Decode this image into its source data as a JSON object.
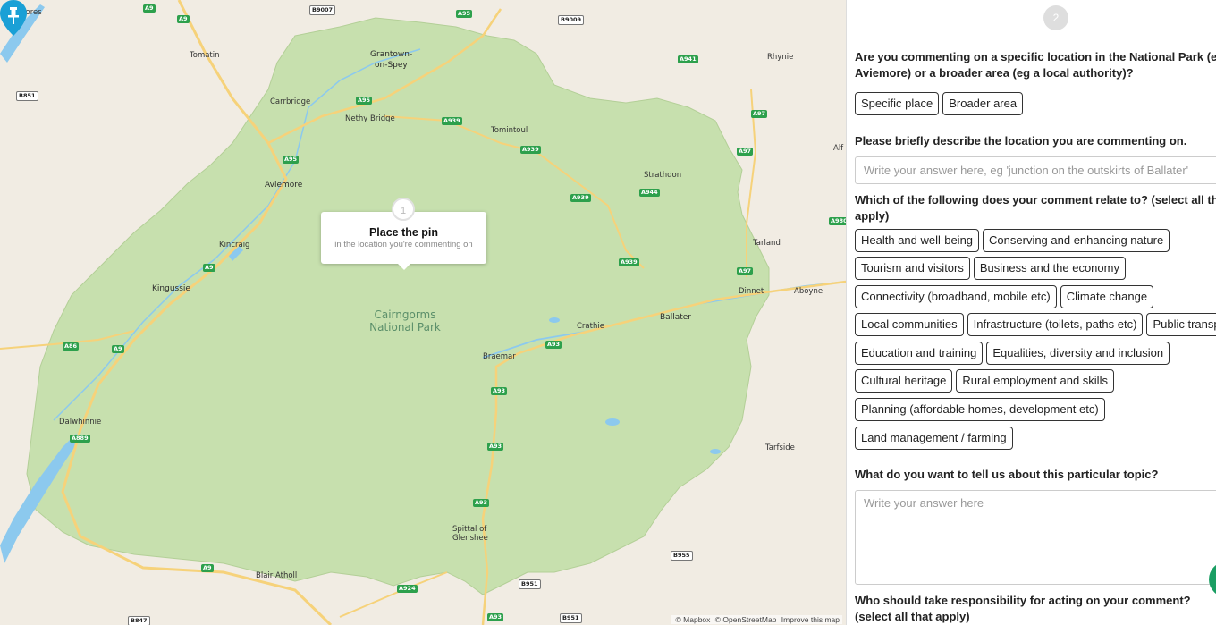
{
  "map": {
    "park_name_line1": "Cairngorms",
    "park_name_line2": "National Park",
    "popup": {
      "step_number": "1",
      "title": "Place the pin",
      "subtitle": "in the location you're commenting on"
    },
    "places": [
      "Dores",
      "Tomatin",
      "Grantown-",
      "on-Spey",
      "Carrbridge",
      "Nethy Bridge",
      "Tomintoul",
      "Rhynie",
      "Aviemore",
      "Strathdon",
      "Kincraig",
      "Kingussie",
      "Tarland",
      "Dinnet",
      "Aboyne",
      "Crathie",
      "Ballater",
      "Braemar",
      "Dalwhinnie",
      "Tarfside",
      "Spittal of",
      "Glenshee",
      "Blair Atholl",
      "Alf"
    ],
    "roads": [
      "A9",
      "A9",
      "B9007",
      "A95",
      "B9009",
      "B851",
      "A95",
      "A939",
      "A941",
      "A97",
      "A95",
      "A939",
      "A97",
      "A939",
      "A944",
      "A9",
      "A939",
      "A97",
      "A980",
      "A86",
      "A9",
      "A93",
      "A93",
      "A889",
      "A93",
      "A93",
      "A9",
      "B955",
      "A924",
      "B951",
      "A93",
      "B951",
      "B847"
    ],
    "attribution": {
      "mapbox": "© Mapbox",
      "osm": "© OpenStreetMap",
      "improve": "Improve this map"
    },
    "colors": {
      "park": "#c9e2b1",
      "water": "#7cc7ee",
      "road": "#f6d27a",
      "pin": "#1aa0d6"
    }
  },
  "form": {
    "step_number": "2",
    "q1": "Are you commenting on a specific location in the National Park (eg Aviemore) or a broader area (eg a local authority)?",
    "q1_options": [
      "Specific place",
      "Broader area"
    ],
    "q2": "Please briefly describe the location you are commenting on.",
    "q2_placeholder": "Write your answer here, eg 'junction on the outskirts of Ballater'",
    "q3": "Which of the following does your comment relate to? (select all that apply)",
    "topics": [
      [
        "Health and well-being",
        "Conserving and enhancing nature"
      ],
      [
        "Tourism and visitors",
        "Business and the economy"
      ],
      [
        "Connectivity (broadband, mobile etc)",
        "Climate change"
      ],
      [
        "Local communities",
        "Infrastructure (toilets, paths etc)",
        "Public transport"
      ],
      [
        "Education and training",
        "Equalities, diversity and inclusion"
      ],
      [
        "Cultural heritage",
        "Rural employment and skills"
      ],
      [
        "Planning (affordable homes, development etc)"
      ],
      [
        "Land management / farming"
      ]
    ],
    "q4": "What do you want to tell us about this particular topic?",
    "q4_placeholder": "Write your answer here",
    "q5": "Who should take responsibility for acting on your comment? (select all that apply)"
  }
}
